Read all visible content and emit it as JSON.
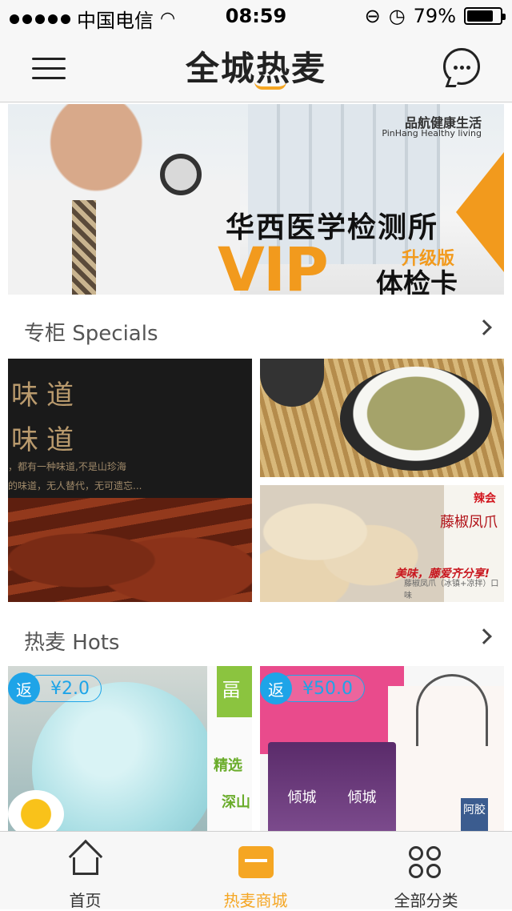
{
  "status": {
    "carrier": "中国电信",
    "time": "08:59",
    "battery": "79%",
    "battery_level": 0.79
  },
  "header": {
    "title": "全城热麦"
  },
  "banner": {
    "brand_cn": "品航健康生活",
    "brand_en": "PinHang Healthy living",
    "title": "华西医学检测所",
    "vip": "VIP",
    "edition": "升级版",
    "card": "体检卡"
  },
  "specials": {
    "label": "专柜 Specials",
    "left": {
      "title1": "味道",
      "title2": "味道",
      "line1": "，都有一种味道,不是山珍海",
      "line2": "的味道，无人替代，无可遗忘..."
    },
    "bottom_right": {
      "brand": "辣会",
      "name": "藤椒凤爪",
      "slogan": "美味，藤爱齐分享!",
      "note": "藤椒凤爪（冰镇+凉拌）口味"
    }
  },
  "hots": {
    "label": "热麦 Hots",
    "items": [
      {
        "rebate_icon": "返",
        "rebate": "¥2.0",
        "side_line1": "精选",
        "side_line2": "深山"
      },
      {
        "rebate_icon": "返",
        "rebate": "¥50.0",
        "pkg_label": "倾城",
        "box_label": "阿胶"
      }
    ]
  },
  "tabs": [
    {
      "label": "首页",
      "icon": "home-icon"
    },
    {
      "label": "热麦商城",
      "icon": "store-icon",
      "active": true
    },
    {
      "label": "全部分类",
      "icon": "grid-icon"
    }
  ],
  "colors": {
    "accent": "#f5a623",
    "rebate_blue": "#1ea4e8"
  }
}
